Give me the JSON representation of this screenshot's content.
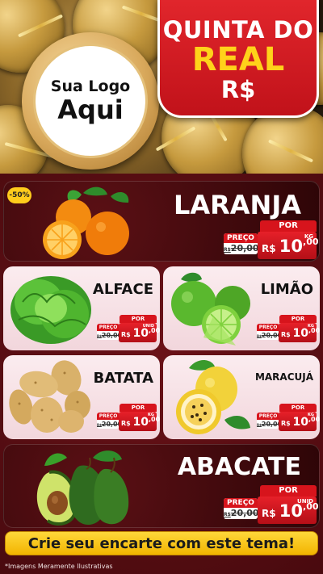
{
  "header": {
    "logo": {
      "line1": "Sua Logo",
      "line2": "Aqui"
    },
    "badge": {
      "line1": "QUINTA DO",
      "line2": "REAL",
      "line3": "R$"
    }
  },
  "colors": {
    "red": "#d7141c",
    "gold": "#ffd21a",
    "dark_red": "#3d070b",
    "light_pink": "#f7e2e6"
  },
  "discount_badge": "-50%",
  "products": {
    "laranja": {
      "name": "LARANJA",
      "por": "POR",
      "preco": "PREÇO",
      "old_prefix": "R$",
      "old_price": "20,00",
      "currency": "R$",
      "price_int": "10",
      "price_dec": ",00",
      "unit": "KG"
    },
    "alface": {
      "name": "ALFACE",
      "por": "POR",
      "preco": "PREÇO",
      "old_prefix": "R$",
      "old_price": "20,00",
      "currency": "R$",
      "price_int": "10",
      "price_dec": ",00",
      "unit": "UNID"
    },
    "limao": {
      "name": "LIMÃO",
      "por": "POR",
      "preco": "PREÇO",
      "old_prefix": "R$",
      "old_price": "20,00",
      "currency": "R$",
      "price_int": "10",
      "price_dec": ",00",
      "unit": "KG"
    },
    "batata": {
      "name": "BATATA",
      "por": "POR",
      "preco": "PREÇO",
      "old_prefix": "R$",
      "old_price": "20,00",
      "currency": "R$",
      "price_int": "10",
      "price_dec": ",00",
      "unit": "KG"
    },
    "maracuja": {
      "name": "MARACUJÁ",
      "por": "POR",
      "preco": "PREÇO",
      "old_prefix": "R$",
      "old_price": "20,00",
      "currency": "R$",
      "price_int": "10",
      "price_dec": ",00",
      "unit": "KG"
    },
    "abacate": {
      "name": "ABACATE",
      "por": "POR",
      "preco": "PREÇO",
      "old_prefix": "R$",
      "old_price": "20,00",
      "currency": "R$",
      "price_int": "10",
      "price_dec": ",00",
      "unit": "UNID"
    }
  },
  "cta": "Crie seu encarte com este tema!",
  "disclaimer": "*Imagens Meramente Ilustrativas"
}
